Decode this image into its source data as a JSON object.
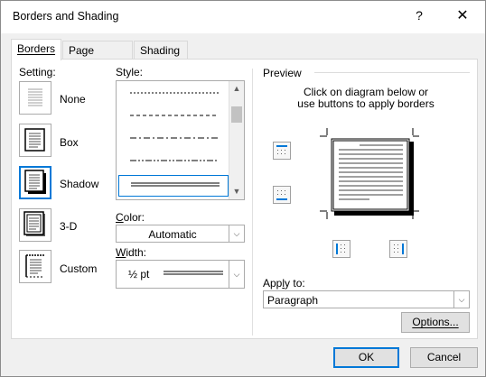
{
  "window": {
    "title": "Borders and Shading",
    "help_label": "?",
    "close_label": "✕"
  },
  "tabs": [
    {
      "label": "Borders",
      "mnemonic": "B",
      "active": true
    },
    {
      "label": "Page Border",
      "mnemonic": "P",
      "active": false
    },
    {
      "label": "Shading",
      "mnemonic": "S",
      "active": false
    }
  ],
  "setting": {
    "heading": "Setting:",
    "options": [
      {
        "label": "None",
        "mnemonic": "N",
        "icon": "setting-none-icon"
      },
      {
        "label": "Box",
        "mnemonic": "x",
        "icon": "setting-box-icon"
      },
      {
        "label": "Shadow",
        "mnemonic": "a",
        "icon": "setting-shadow-icon",
        "selected": true
      },
      {
        "label": "3-D",
        "mnemonic": "D",
        "icon": "setting-3d-icon"
      },
      {
        "label": "Custom",
        "mnemonic": "U",
        "icon": "setting-custom-icon"
      }
    ]
  },
  "style": {
    "heading": "Style:",
    "items": [
      "dashed-fine",
      "dashed-medium",
      "dash-dot",
      "dash-dot-dot",
      "double"
    ],
    "selected": "double"
  },
  "color": {
    "heading": "Color:",
    "mnemonic": "C",
    "value": "Automatic"
  },
  "width": {
    "heading": "Width:",
    "mnemonic": "W",
    "value": "½ pt"
  },
  "preview": {
    "heading": "Preview",
    "instruction_line1": "Click on diagram below or",
    "instruction_line2": "use buttons to apply borders"
  },
  "apply_to": {
    "heading": "Apply to:",
    "mnemonic": "L",
    "value": "Paragraph"
  },
  "buttons": {
    "options": "Options...",
    "ok": "OK",
    "cancel": "Cancel"
  },
  "colors": {
    "accent": "#0078d7",
    "window_bg": "#f0f0f0",
    "panel_bg": "#ffffff"
  }
}
